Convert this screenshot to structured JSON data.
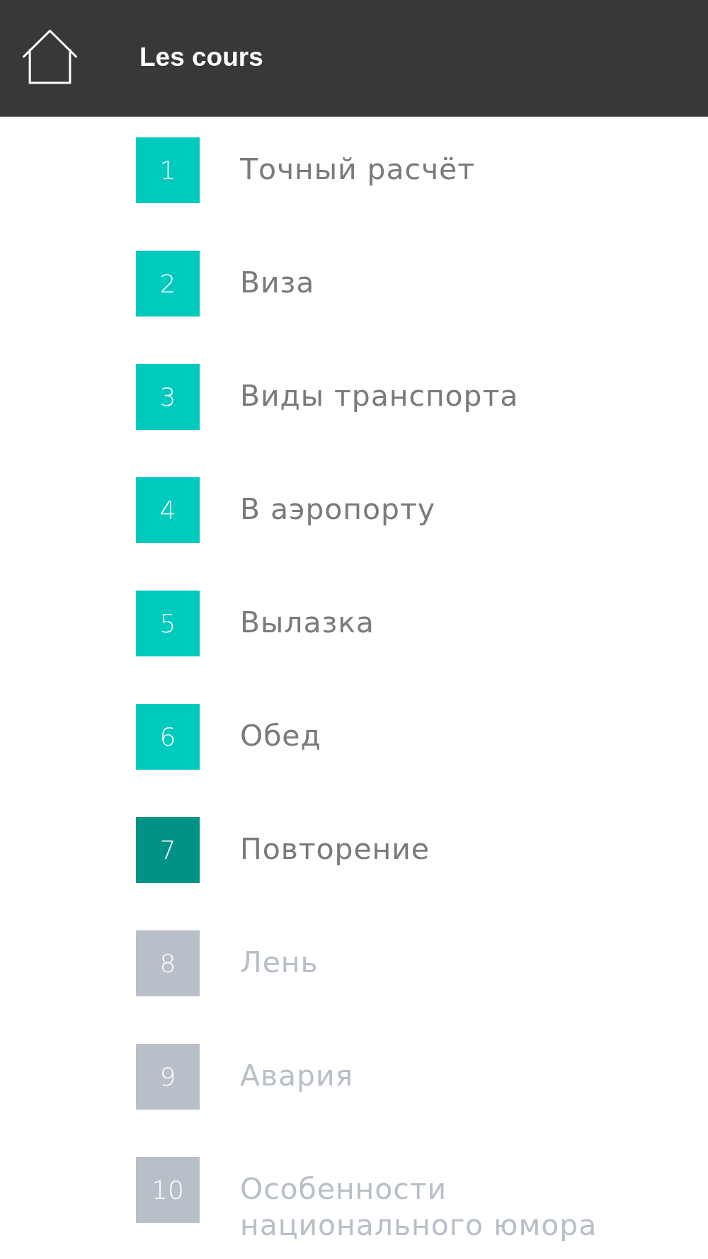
{
  "header": {
    "title": "Les cours"
  },
  "lessons": [
    {
      "number": "1",
      "title": "Точный расчёт",
      "selected": false,
      "disabled": false
    },
    {
      "number": "2",
      "title": "Виза",
      "selected": false,
      "disabled": false
    },
    {
      "number": "3",
      "title": "Виды транспорта",
      "selected": false,
      "disabled": false
    },
    {
      "number": "4",
      "title": "В аэропорту",
      "selected": false,
      "disabled": false
    },
    {
      "number": "5",
      "title": "Вылазка",
      "selected": false,
      "disabled": false
    },
    {
      "number": "6",
      "title": "Обед",
      "selected": false,
      "disabled": false
    },
    {
      "number": "7",
      "title": "Повторение",
      "selected": true,
      "disabled": false
    },
    {
      "number": "8",
      "title": "Лень",
      "selected": false,
      "disabled": true
    },
    {
      "number": "9",
      "title": "Авария",
      "selected": false,
      "disabled": true
    },
    {
      "number": "10",
      "title": "Особенности национального юмора",
      "selected": false,
      "disabled": true
    }
  ]
}
